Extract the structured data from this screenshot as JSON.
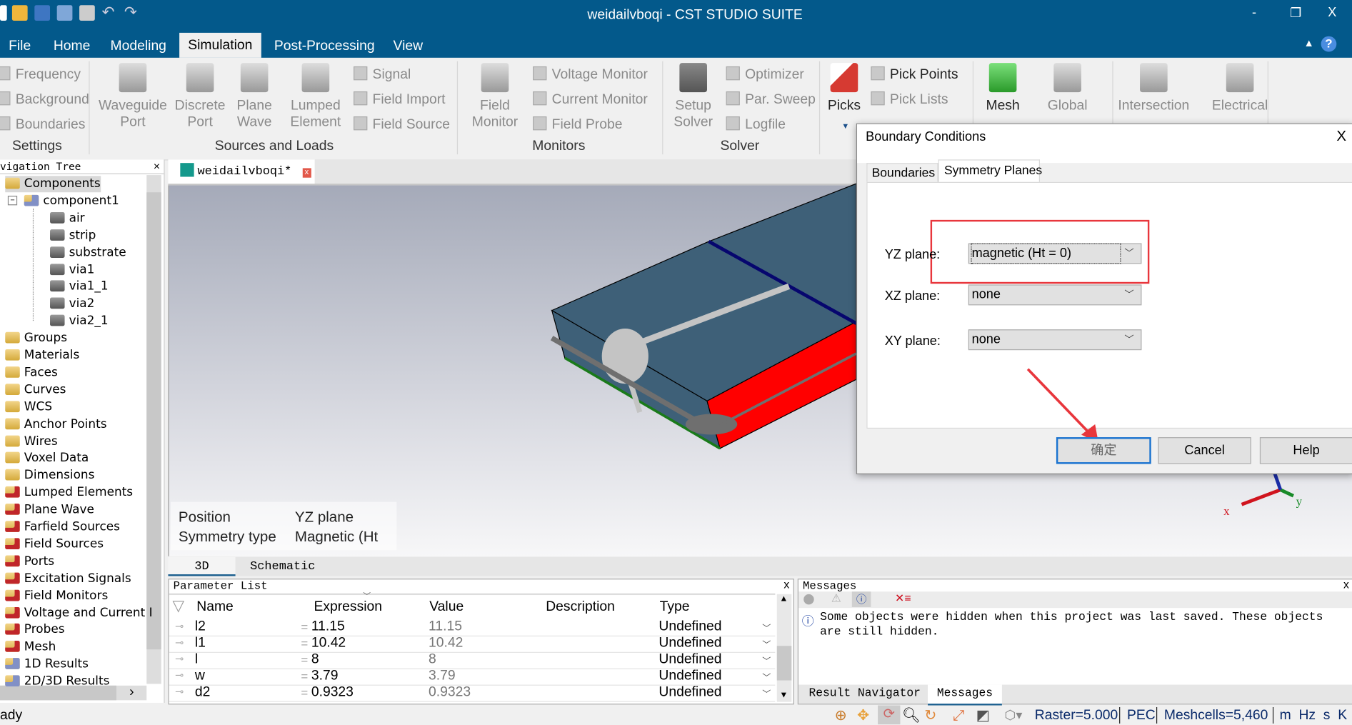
{
  "window": {
    "title": "weidailvboqi - CST STUDIO SUITE",
    "minimize": "-",
    "restore": "❐",
    "close": "X"
  },
  "menu": {
    "tabs": [
      "File",
      "Home",
      "Modeling",
      "Simulation",
      "Post-Processing",
      "View"
    ],
    "active": "Simulation"
  },
  "ribbon": {
    "settings": {
      "items": [
        "Frequency",
        "Background",
        "Boundaries"
      ],
      "group": "Settings"
    },
    "sources": {
      "big": [
        [
          "Waveguide",
          "Port"
        ],
        [
          "Discrete",
          "Port"
        ],
        [
          "Plane",
          "Wave"
        ],
        [
          "Lumped",
          "Element"
        ]
      ],
      "small": [
        "Signal",
        "Field Import",
        "Field Source"
      ],
      "group": "Sources and Loads"
    },
    "monitors": {
      "big": [
        "Field",
        "Monitor"
      ],
      "small": [
        "Voltage Monitor",
        "Current Monitor",
        "Field Probe"
      ],
      "group": "Monitors"
    },
    "solver": {
      "big": [
        "Setup",
        "Solver"
      ],
      "small": [
        "Optimizer",
        "Par. Sweep",
        "Logfile"
      ],
      "group": "Solver"
    },
    "picks": {
      "big": "Picks",
      "small": [
        "Pick Points",
        "Pick Lists"
      ]
    },
    "mesh": {
      "big": [
        "Mesh",
        "Global"
      ]
    },
    "checks": {
      "big": [
        "Intersection",
        "Electrical"
      ]
    }
  },
  "navtree": {
    "title": "vigation Tree",
    "close": "×",
    "items": [
      {
        "label": "Components",
        "level": 0,
        "icon": "folder",
        "selected": true
      },
      {
        "label": "component1",
        "level": 1,
        "icon": "component"
      },
      {
        "label": "air",
        "level": 2,
        "icon": "solid"
      },
      {
        "label": "strip",
        "level": 2,
        "icon": "solid"
      },
      {
        "label": "substrate",
        "level": 2,
        "icon": "solid"
      },
      {
        "label": "via1",
        "level": 2,
        "icon": "solid"
      },
      {
        "label": "via1_1",
        "level": 2,
        "icon": "solid"
      },
      {
        "label": "via2",
        "level": 2,
        "icon": "solid"
      },
      {
        "label": "via2_1",
        "level": 2,
        "icon": "solid"
      },
      {
        "label": "Groups",
        "level": 0,
        "icon": "folder"
      },
      {
        "label": "Materials",
        "level": 0,
        "icon": "folder"
      },
      {
        "label": "Faces",
        "level": 0,
        "icon": "folder"
      },
      {
        "label": "Curves",
        "level": 0,
        "icon": "folder"
      },
      {
        "label": "WCS",
        "level": 0,
        "icon": "folder"
      },
      {
        "label": "Anchor Points",
        "level": 0,
        "icon": "folder"
      },
      {
        "label": "Wires",
        "level": 0,
        "icon": "folder"
      },
      {
        "label": "Voxel Data",
        "level": 0,
        "icon": "folder"
      },
      {
        "label": "Dimensions",
        "level": 0,
        "icon": "folder"
      },
      {
        "label": "Lumped Elements",
        "level": 0,
        "icon": "folder-red"
      },
      {
        "label": "Plane Wave",
        "level": 0,
        "icon": "folder-red"
      },
      {
        "label": "Farfield Sources",
        "level": 0,
        "icon": "folder-red"
      },
      {
        "label": "Field Sources",
        "level": 0,
        "icon": "folder-red"
      },
      {
        "label": "Ports",
        "level": 0,
        "icon": "folder-red"
      },
      {
        "label": "Excitation Signals",
        "level": 0,
        "icon": "folder-red"
      },
      {
        "label": "Field Monitors",
        "level": 0,
        "icon": "folder-red"
      },
      {
        "label": "Voltage and Current I",
        "level": 0,
        "icon": "folder-red"
      },
      {
        "label": "Probes",
        "level": 0,
        "icon": "folder-red"
      },
      {
        "label": "Mesh",
        "level": 0,
        "icon": "folder-red"
      },
      {
        "label": "1D Results",
        "level": 0,
        "icon": "folder-blue"
      },
      {
        "label": "2D/3D Results",
        "level": 0,
        "icon": "folder-blue"
      }
    ]
  },
  "document": {
    "tab": "weidailvboqi*"
  },
  "viewport": {
    "info": [
      [
        "Position",
        "YZ plane"
      ],
      [
        "Symmetry type",
        "Magnetic (Ht"
      ]
    ],
    "axis_x": "x",
    "axis_y": "y"
  },
  "viewtabs": [
    "3D",
    "Schematic"
  ],
  "params": {
    "title": "Parameter List",
    "close": "x",
    "columns": [
      "Name",
      "Expression",
      "Value",
      "Description",
      "Type"
    ],
    "rows": [
      [
        "l2",
        "11.15",
        "11.15",
        "",
        "Undefined"
      ],
      [
        "l1",
        "10.42",
        "10.42",
        "",
        "Undefined"
      ],
      [
        "l",
        "8",
        "8",
        "",
        "Undefined"
      ],
      [
        "w",
        "3.79",
        "3.79",
        "",
        "Undefined"
      ],
      [
        "d2",
        "0.9323",
        "0.9323",
        "",
        "Undefined"
      ]
    ]
  },
  "messages": {
    "title": "Messages",
    "close": "x",
    "text": "Some objects were hidden when this project was last saved. These objects are still hidden.",
    "tabs": [
      "Result Navigator",
      "Messages"
    ]
  },
  "status": {
    "left": "ady",
    "raster": "Raster=5.000",
    "material": "PEC",
    "meshcells": "Meshcells=5,460",
    "units": "m  Hz  s  K"
  },
  "dialog": {
    "title": "Boundary Conditions",
    "close": "X",
    "tabs": [
      "Boundaries",
      "Symmetry Planes"
    ],
    "fields": [
      {
        "label": "YZ plane:",
        "value": "magnetic (Ht = 0)"
      },
      {
        "label": "XZ plane:",
        "value": "none"
      },
      {
        "label": "XY plane:",
        "value": "none"
      }
    ],
    "ok": "确定",
    "cancel": "Cancel",
    "help": "Help",
    "highlight_color": "#e8363c"
  },
  "colors": {
    "titlebar": "#03598b",
    "substrate_top": "#3e6078",
    "side": "#ff0000",
    "strip": "#c4c4c4"
  }
}
